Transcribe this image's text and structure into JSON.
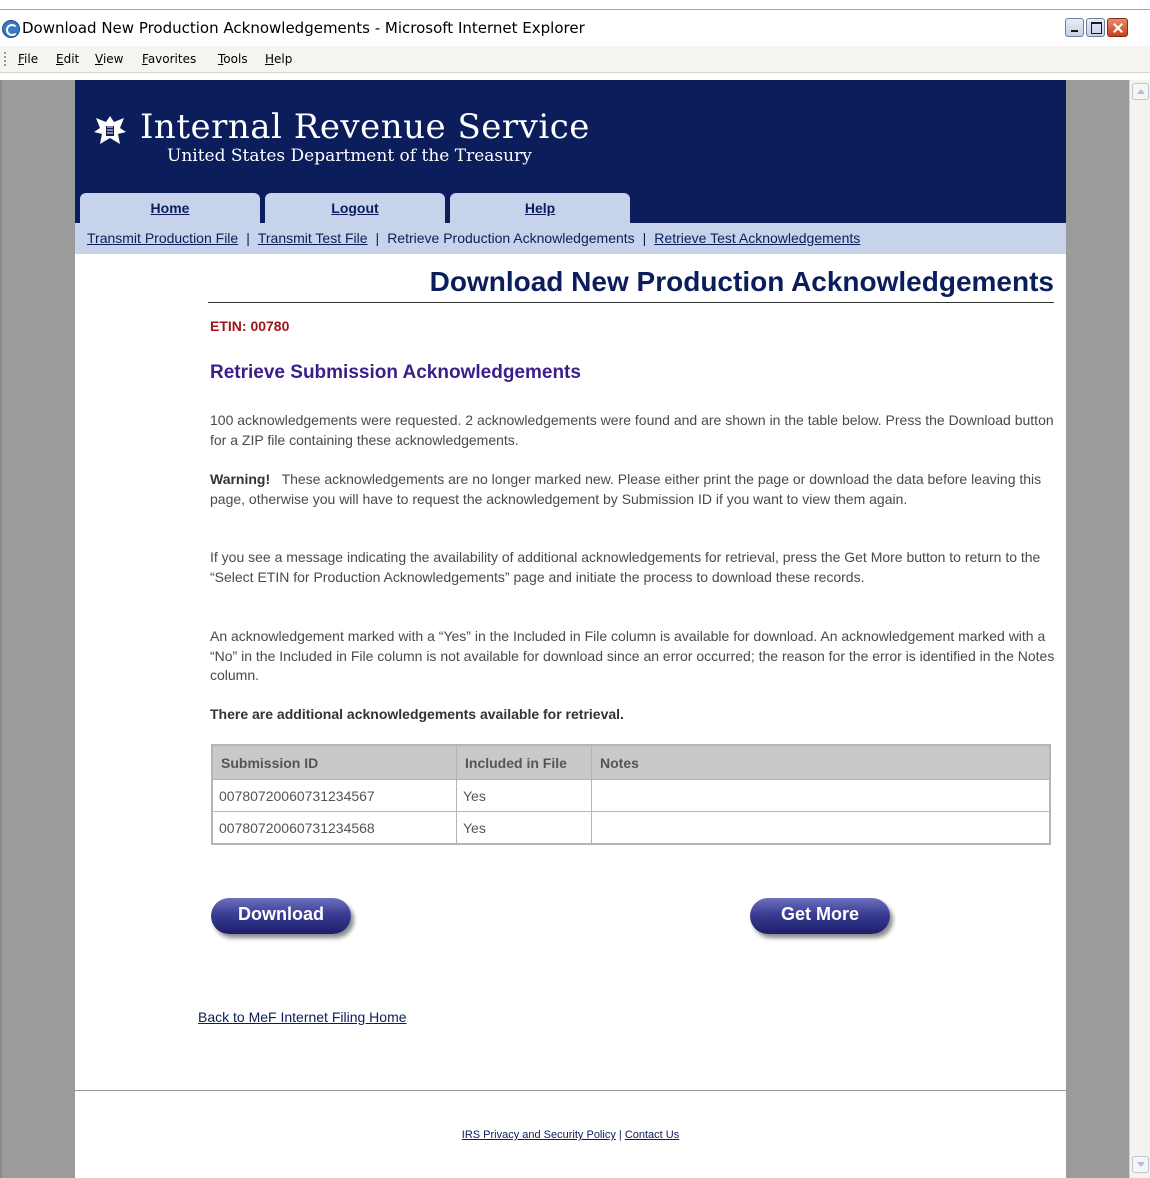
{
  "window": {
    "title": "Download New Production Acknowledgements - Microsoft Internet Explorer"
  },
  "menu": [
    "File",
    "Edit",
    "View",
    "Favorites",
    "Tools",
    "Help"
  ],
  "header": {
    "title": "Internal Revenue Service",
    "subtitle": "United States Department of the Treasury",
    "tabs": [
      "Home",
      "Logout",
      "Help"
    ]
  },
  "subnav": {
    "links": [
      "Transmit Production File",
      "Transmit Test File",
      "Retrieve Production Acknowledgements",
      "Retrieve Test Acknowledgements"
    ],
    "separator": "|"
  },
  "page": {
    "title": "Download New Production Acknowledgements",
    "etin_label": "ETIN:",
    "etin_value": "00780",
    "section_heading": "Retrieve Submission Acknowledgements",
    "para1": "100 acknowledgements were requested. 2 acknowledgements were found and are shown in the table below. Press the Download button for a ZIP file containing these acknowledgements.",
    "warning_label": "Warning!",
    "warning_text": "These acknowledgements are no longer marked new. Please either print the page or download the data before leaving this page, otherwise you will have to request the acknowledgement by Submission ID if you want to view them again.",
    "para3": "If you see a message indicating the availability of additional acknowledgements for retrieval, press the Get More button to return to the “Select ETIN for Production Acknowledgements” page and initiate the process to download these records.",
    "para4": "An acknowledgement marked with a “Yes” in the Included in File column is available for download. An acknowledgement marked with a “No” in the Included in File column is not available for download since an error occurred; the reason for the error is identified in the Notes column.",
    "additional": "There are additional acknowledgements available for retrieval.",
    "download_label": "Download",
    "getmore_label": "Get More",
    "back_link": "Back to MeF Internet Filing Home"
  },
  "table": {
    "columns": [
      "Submission ID",
      "Included in File",
      "Notes"
    ],
    "rows": [
      [
        "00780720060731234567",
        "Yes",
        ""
      ],
      [
        "00780720060731234568",
        "Yes",
        ""
      ]
    ]
  },
  "footer": {
    "privacy": "IRS Privacy and Security Policy",
    "sep": "|",
    "contact": "Contact Us"
  },
  "colors": {
    "irs_navy": "#0b1e5b",
    "nav_blue": "#c7d3ea",
    "etin_red": "#a0141a",
    "heading_purple": "#3a1e8c"
  },
  "icons": [
    "ie-icon",
    "minimize-icon",
    "maximize-icon",
    "close-icon",
    "windows-flag-icon",
    "irs-eagle-logo-icon",
    "scroll-up-icon",
    "scroll-down-icon"
  ]
}
